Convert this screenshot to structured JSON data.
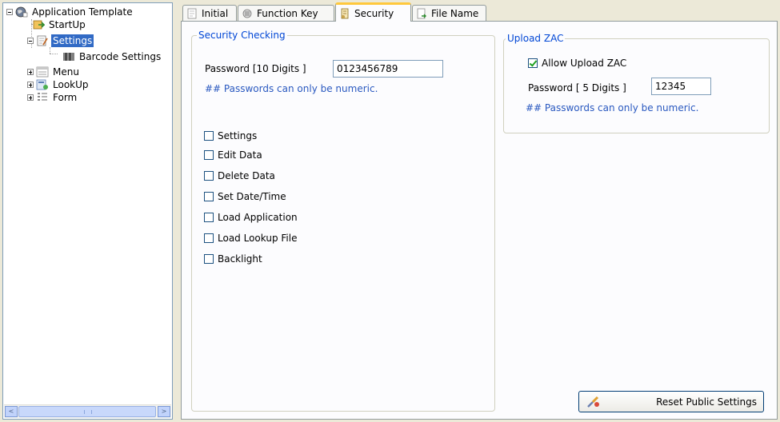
{
  "tree": {
    "items": [
      {
        "label": "Application Template",
        "icon": "globe-icon",
        "expander": "minus",
        "selected": false
      },
      {
        "label": "StartUp",
        "icon": "startup-icon",
        "expander": "none",
        "selected": false
      },
      {
        "label": "Settings",
        "icon": "settings-icon",
        "expander": "minus",
        "selected": true
      },
      {
        "label": "Barcode Settings",
        "icon": "barcode-icon",
        "expander": "none",
        "selected": false
      },
      {
        "label": "Menu",
        "icon": "menu-icon",
        "expander": "plus",
        "selected": false
      },
      {
        "label": "LookUp",
        "icon": "lookup-icon",
        "expander": "plus",
        "selected": false
      },
      {
        "label": "Form",
        "icon": "form-icon",
        "expander": "plus",
        "selected": false
      }
    ]
  },
  "tabs": [
    {
      "label": "Initial",
      "icon": "document-icon",
      "active": false
    },
    {
      "label": "Function Key",
      "icon": "keyboard-icon",
      "active": false
    },
    {
      "label": "Security",
      "icon": "security-icon",
      "active": true
    },
    {
      "label": "File Name",
      "icon": "file-icon",
      "active": false
    }
  ],
  "security": {
    "legend": "Security Checking",
    "password_label": "Password [10 Digits ]",
    "password_value": "0123456789",
    "hint": "## Passwords can only be numeric.",
    "checks": [
      {
        "label": "Settings",
        "checked": false
      },
      {
        "label": "Edit Data",
        "checked": false
      },
      {
        "label": "Delete Data",
        "checked": false
      },
      {
        "label": "Set Date/Time",
        "checked": false
      },
      {
        "label": "Load Application",
        "checked": false
      },
      {
        "label": "Load Lookup File",
        "checked": false
      },
      {
        "label": "Backlight",
        "checked": false
      }
    ]
  },
  "upload": {
    "legend": "Upload ZAC",
    "allow_label": "Allow Upload ZAC",
    "allow_checked": true,
    "password_label": "Password [ 5 Digits ]",
    "password_value": "12345",
    "hint": "## Passwords can only be numeric."
  },
  "reset_button": {
    "label": "Reset Public Settings",
    "icon": "reset-icon"
  },
  "scrollbar": {
    "left_arrow": "<",
    "right_arrow": ">"
  },
  "colors": {
    "accent": "#316ac5",
    "legend": "#0046d5",
    "hint": "#2a59c0",
    "tab_highlight": "#ffc83c"
  }
}
